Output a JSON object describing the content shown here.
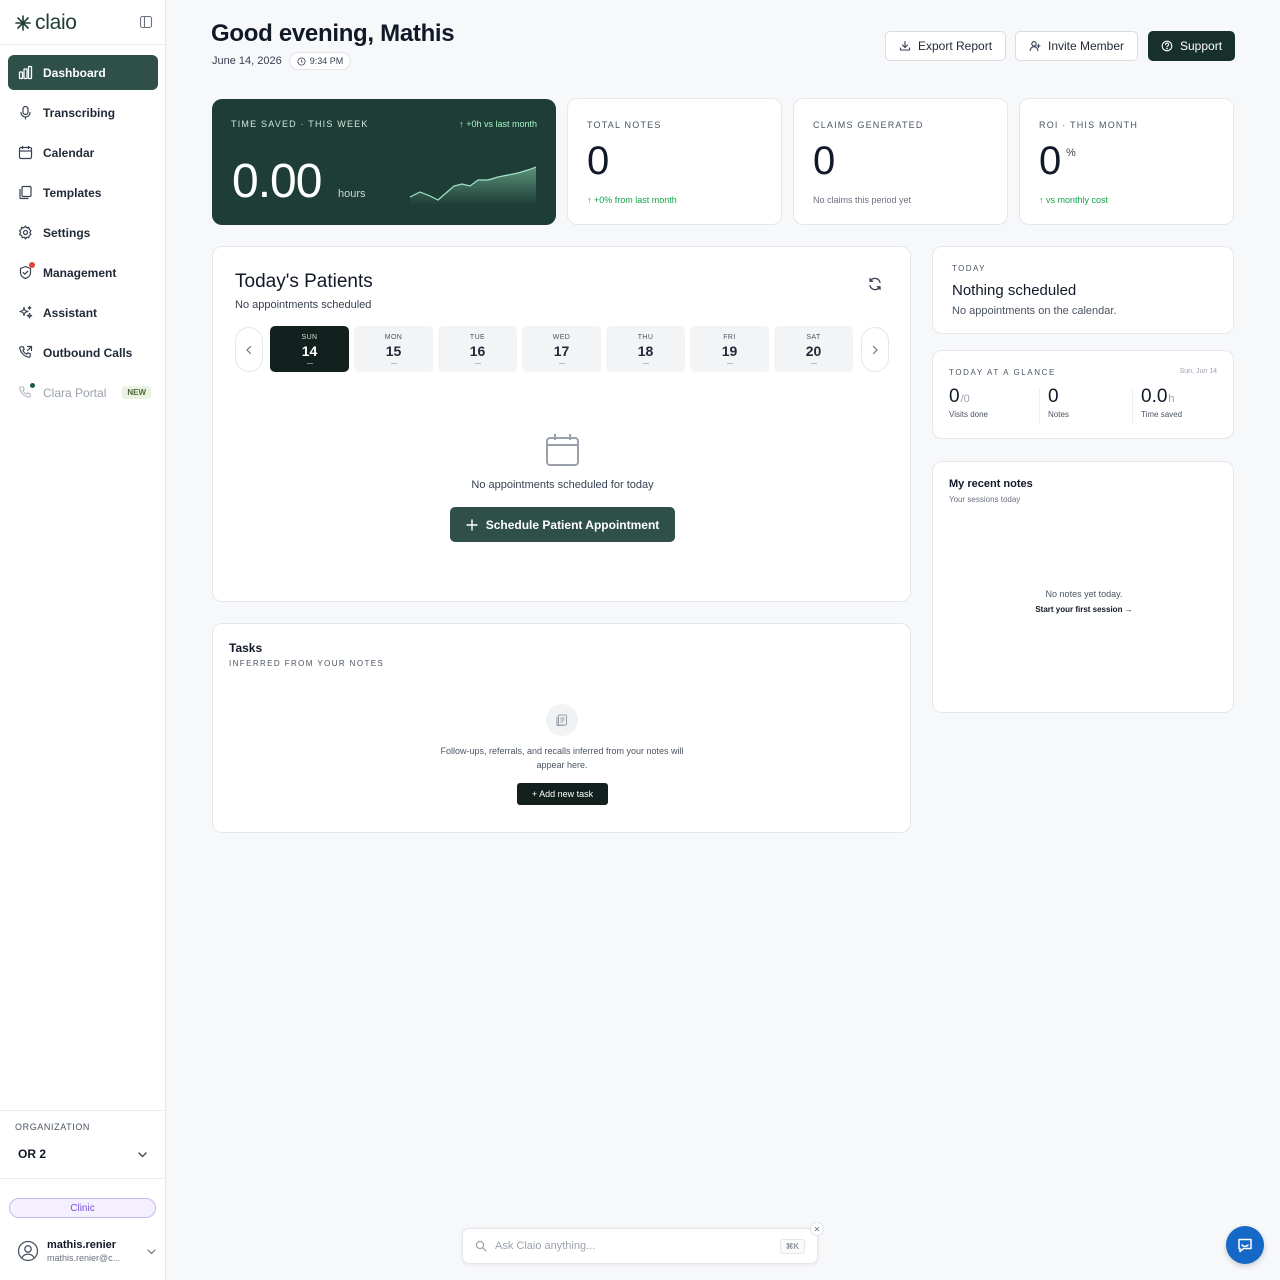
{
  "brand": {
    "name": "claio"
  },
  "sidebar": {
    "items": [
      {
        "label": "Dashboard",
        "icon": "bar-chart-icon",
        "active": true
      },
      {
        "label": "Transcribing",
        "icon": "microphone-icon"
      },
      {
        "label": "Calendar",
        "icon": "calendar-icon"
      },
      {
        "label": "Templates",
        "icon": "documents-icon"
      },
      {
        "label": "Settings",
        "icon": "gear-icon"
      },
      {
        "label": "Management",
        "icon": "shield-icon"
      },
      {
        "label": "Assistant",
        "icon": "sparkles-icon"
      },
      {
        "label": "Outbound Calls",
        "icon": "phone-outgoing-icon"
      },
      {
        "label": "Clara Portal",
        "icon": "phone-icon",
        "badge": "NEW"
      }
    ],
    "organization": {
      "label": "ORGANIZATION",
      "value": "OR 2"
    },
    "plan_badge": "Clinic",
    "user": {
      "name": "mathis.renier",
      "email": "mathis.renier@c..."
    }
  },
  "header": {
    "greeting": "Good evening, Mathis",
    "date": "June 14, 2026",
    "time": "9:34 PM",
    "buttons": {
      "export": "Export Report",
      "invite": "Invite Member",
      "support": "Support"
    }
  },
  "stats": {
    "time_saved": {
      "label": "TIME SAVED · THIS WEEK",
      "delta": "+0h vs last month",
      "value": "0.00",
      "unit": "hours"
    },
    "total_notes": {
      "label": "TOTAL NOTES",
      "value": "0",
      "foot": "+0% from last month"
    },
    "claims": {
      "label": "CLAIMS GENERATED",
      "value": "0",
      "foot": "No claims this period yet"
    },
    "roi": {
      "label": "ROI · THIS MONTH",
      "value": "0",
      "suffix": "%",
      "foot": "vs monthly cost"
    }
  },
  "patients": {
    "title": "Today's Patients",
    "subtitle": "No appointments scheduled",
    "days": [
      {
        "dow": "SUN",
        "num": "14"
      },
      {
        "dow": "MON",
        "num": "15"
      },
      {
        "dow": "TUE",
        "num": "16"
      },
      {
        "dow": "WED",
        "num": "17"
      },
      {
        "dow": "THU",
        "num": "18"
      },
      {
        "dow": "FRI",
        "num": "19"
      },
      {
        "dow": "SAT",
        "num": "20"
      }
    ],
    "empty_text": "No appointments scheduled for today",
    "schedule_button": "Schedule Patient Appointment"
  },
  "tasks": {
    "title": "Tasks",
    "subtitle": "INFERRED FROM YOUR NOTES",
    "description": "Follow-ups, referrals, and recalls inferred from your notes will appear here.",
    "add_button": "+ Add new task"
  },
  "today": {
    "label": "TODAY",
    "title": "Nothing scheduled",
    "subtitle": "No appointments on the calendar."
  },
  "glance": {
    "label": "TODAY AT A GLANCE",
    "date": "Sun, Jun 14",
    "visits": {
      "value": "0",
      "suffix": "/0",
      "label": "Visits done"
    },
    "notes": {
      "value": "0",
      "label": "Notes"
    },
    "time": {
      "value": "0.0",
      "suffix": "h",
      "label": "Time saved"
    }
  },
  "recent_notes": {
    "title": "My recent notes",
    "subtitle": "Your sessions today",
    "empty": "No notes yet today.",
    "link": "Start your first session →"
  },
  "ask": {
    "placeholder": "Ask Claio anything...",
    "shortcut": "⌘K"
  },
  "colors": {
    "primary": "#1e3d36",
    "accent_green": "#16a34a",
    "badge_purple": "#7c4fd8",
    "chat_blue": "#1668c7"
  }
}
